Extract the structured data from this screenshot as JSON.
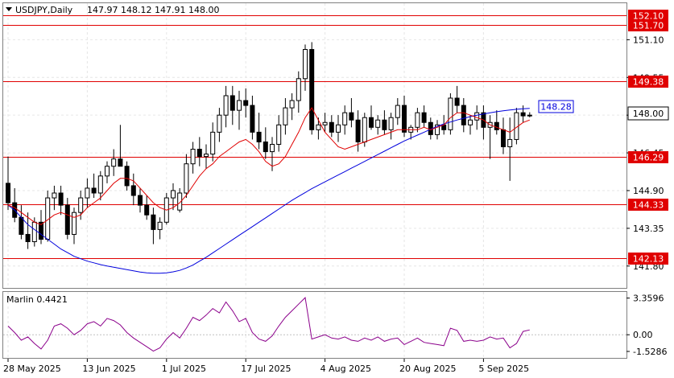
{
  "header": {
    "symbol": "USDJPY,Daily",
    "ohlc": "147.97 148.12 147.91 148.00"
  },
  "chart_data": [
    {
      "type": "candlestick",
      "title": "USDJPY,Daily",
      "ylim": [
        140.9,
        152.6
      ],
      "price_axis_ticks": [
        "151.10",
        "149.55",
        "148.00",
        "146.45",
        "144.90",
        "143.35",
        "141.80"
      ],
      "x_labels": [
        {
          "label": "28 May 2025",
          "index": 0
        },
        {
          "label": "13 Jun 2025",
          "index": 12
        },
        {
          "label": "1 Jul 2025",
          "index": 24
        },
        {
          "label": "17 Jul 2025",
          "index": 36
        },
        {
          "label": "4 Aug 2025",
          "index": 48
        },
        {
          "label": "20 Aug 2025",
          "index": 60
        },
        {
          "label": "5 Sep 2025",
          "index": 72
        }
      ],
      "current_price": "148.00",
      "ma_value_label": "148.28",
      "levels": [
        {
          "value": 152.1,
          "label": "152.10",
          "color": "#e00000"
        },
        {
          "value": 151.7,
          "label": "151.70",
          "color": "#e00000"
        },
        {
          "value": 149.38,
          "label": "149.38",
          "color": "#e00000"
        },
        {
          "value": 146.29,
          "label": "146.29",
          "color": "#e00000"
        },
        {
          "value": 144.33,
          "label": "144.33",
          "color": "#e00000"
        },
        {
          "value": 142.13,
          "label": "142.13",
          "color": "#e00000"
        }
      ],
      "colors": {
        "candles": "#000000",
        "fast_ma": "#e00000",
        "slow_ma": "#0000dd",
        "levels": "#e00000",
        "ma_label": "#0000dd"
      },
      "ohlc": [
        [
          145.2,
          146.3,
          144.1,
          144.4
        ],
        [
          144.4,
          145.0,
          143.6,
          143.8
        ],
        [
          143.8,
          144.3,
          142.9,
          143.1
        ],
        [
          143.1,
          144.0,
          142.5,
          142.8
        ],
        [
          142.8,
          143.8,
          142.6,
          143.6
        ],
        [
          143.6,
          144.1,
          142.7,
          142.9
        ],
        [
          142.9,
          144.9,
          142.8,
          144.6
        ],
        [
          144.6,
          145.1,
          144.1,
          144.8
        ],
        [
          144.8,
          145.1,
          143.9,
          144.3
        ],
        [
          144.3,
          144.6,
          142.9,
          143.1
        ],
        [
          143.1,
          144.2,
          142.7,
          144.0
        ],
        [
          144.0,
          144.9,
          143.7,
          144.6
        ],
        [
          144.6,
          145.4,
          144.2,
          145.0
        ],
        [
          145.0,
          145.6,
          144.6,
          144.8
        ],
        [
          144.8,
          145.7,
          144.5,
          145.5
        ],
        [
          145.5,
          146.1,
          145.2,
          145.9
        ],
        [
          145.9,
          146.6,
          145.5,
          146.2
        ],
        [
          146.2,
          147.6,
          146.0,
          145.9
        ],
        [
          145.9,
          146.1,
          144.9,
          145.1
        ],
        [
          145.1,
          145.6,
          144.3,
          144.7
        ],
        [
          144.7,
          145.0,
          144.0,
          144.3
        ],
        [
          144.3,
          144.7,
          143.7,
          143.9
        ],
        [
          143.9,
          144.2,
          142.7,
          143.3
        ],
        [
          143.3,
          143.8,
          142.9,
          143.6
        ],
        [
          143.6,
          144.8,
          143.5,
          144.6
        ],
        [
          144.6,
          145.2,
          144.1,
          144.9
        ],
        [
          144.1,
          145.0,
          144.0,
          144.8
        ],
        [
          144.8,
          146.4,
          144.6,
          146.0
        ],
        [
          146.0,
          146.9,
          145.6,
          146.6
        ],
        [
          146.6,
          147.1,
          145.9,
          146.3
        ],
        [
          146.3,
          146.8,
          145.8,
          146.4
        ],
        [
          146.4,
          147.7,
          146.1,
          147.3
        ],
        [
          147.3,
          148.3,
          146.9,
          148.0
        ],
        [
          148.0,
          149.2,
          147.5,
          148.8
        ],
        [
          148.8,
          149.2,
          147.6,
          148.2
        ],
        [
          148.2,
          149.0,
          147.4,
          148.6
        ],
        [
          148.6,
          149.1,
          147.9,
          148.4
        ],
        [
          148.4,
          148.8,
          147.0,
          147.3
        ],
        [
          147.3,
          148.1,
          146.6,
          146.9
        ],
        [
          146.9,
          147.5,
          146.2,
          146.5
        ],
        [
          146.5,
          147.1,
          145.7,
          146.8
        ],
        [
          146.8,
          148.0,
          146.5,
          147.6
        ],
        [
          147.6,
          148.7,
          147.2,
          148.3
        ],
        [
          148.3,
          148.9,
          147.8,
          148.6
        ],
        [
          148.6,
          149.8,
          148.1,
          149.5
        ],
        [
          149.5,
          150.9,
          149.0,
          150.7
        ],
        [
          150.7,
          151.0,
          147.2,
          147.4
        ],
        [
          147.4,
          147.9,
          147.0,
          147.6
        ],
        [
          147.6,
          148.1,
          147.3,
          147.7
        ],
        [
          147.7,
          148.0,
          147.1,
          147.3
        ],
        [
          147.3,
          148.0,
          146.9,
          147.6
        ],
        [
          147.6,
          148.4,
          147.2,
          148.1
        ],
        [
          148.1,
          148.7,
          147.5,
          147.8
        ],
        [
          147.8,
          148.2,
          146.5,
          146.9
        ],
        [
          146.9,
          148.1,
          146.7,
          147.9
        ],
        [
          147.9,
          148.4,
          147.4,
          147.5
        ],
        [
          147.5,
          148.0,
          147.2,
          147.8
        ],
        [
          147.8,
          148.2,
          147.2,
          147.4
        ],
        [
          147.4,
          148.1,
          147.0,
          147.9
        ],
        [
          147.9,
          148.7,
          147.6,
          148.4
        ],
        [
          148.4,
          148.8,
          147.1,
          147.3
        ],
        [
          147.3,
          147.6,
          147.0,
          147.5
        ],
        [
          147.5,
          148.3,
          147.3,
          148.1
        ],
        [
          148.1,
          148.4,
          147.5,
          147.7
        ],
        [
          147.7,
          147.9,
          147.0,
          147.2
        ],
        [
          147.2,
          147.8,
          147.0,
          147.6
        ],
        [
          147.6,
          148.0,
          147.2,
          147.4
        ],
        [
          147.4,
          148.9,
          147.2,
          148.7
        ],
        [
          148.7,
          149.2,
          148.1,
          148.4
        ],
        [
          148.4,
          148.7,
          147.3,
          147.6
        ],
        [
          147.6,
          148.0,
          147.2,
          147.8
        ],
        [
          147.8,
          148.4,
          147.4,
          148.1
        ],
        [
          148.1,
          148.4,
          147.0,
          147.5
        ],
        [
          147.5,
          148.0,
          146.2,
          147.7
        ],
        [
          147.7,
          148.2,
          147.2,
          147.4
        ],
        [
          147.4,
          147.9,
          146.4,
          146.7
        ],
        [
          146.7,
          147.9,
          145.3,
          147.0
        ],
        [
          147.0,
          148.3,
          146.8,
          148.1
        ],
        [
          148.1,
          148.4,
          147.7,
          147.97
        ],
        [
          147.97,
          148.12,
          147.91,
          148.0
        ]
      ],
      "fast_ma": [
        144.3,
        144.2,
        144.0,
        143.8,
        143.6,
        143.5,
        143.7,
        143.9,
        144.0,
        143.9,
        143.8,
        143.9,
        144.2,
        144.4,
        144.6,
        144.9,
        145.2,
        145.4,
        145.4,
        145.3,
        145.0,
        144.7,
        144.4,
        144.2,
        144.1,
        144.2,
        144.4,
        144.7,
        145.1,
        145.5,
        145.8,
        146.0,
        146.3,
        146.5,
        146.7,
        146.9,
        147.0,
        146.8,
        146.5,
        146.1,
        145.9,
        146.0,
        146.3,
        146.8,
        147.3,
        147.9,
        148.3,
        147.8,
        147.3,
        147.0,
        146.7,
        146.6,
        146.7,
        146.8,
        146.9,
        147.0,
        147.1,
        147.2,
        147.3,
        147.4,
        147.4,
        147.4,
        147.4,
        147.5,
        147.4,
        147.5,
        147.6,
        147.9,
        148.1,
        148.1,
        148.0,
        147.9,
        147.8,
        147.6,
        147.5,
        147.4,
        147.3,
        147.5,
        147.7,
        147.8
      ],
      "slow_ma": [
        144.3,
        144.1,
        143.8,
        143.5,
        143.3,
        143.1,
        142.9,
        142.7,
        142.5,
        142.35,
        142.2,
        142.1,
        142.0,
        141.93,
        141.86,
        141.8,
        141.75,
        141.7,
        141.65,
        141.6,
        141.55,
        141.52,
        141.5,
        141.5,
        141.52,
        141.56,
        141.62,
        141.72,
        141.84,
        142.0,
        142.16,
        142.34,
        142.52,
        142.7,
        142.88,
        143.06,
        143.24,
        143.42,
        143.6,
        143.78,
        143.96,
        144.14,
        144.32,
        144.5,
        144.66,
        144.82,
        144.98,
        145.12,
        145.26,
        145.4,
        145.54,
        145.68,
        145.82,
        145.96,
        146.1,
        146.24,
        146.38,
        146.52,
        146.66,
        146.8,
        146.94,
        147.06,
        147.18,
        147.3,
        147.42,
        147.54,
        147.64,
        147.72,
        147.8,
        147.87,
        147.94,
        148.0,
        148.05,
        148.1,
        148.14,
        148.18,
        148.21,
        148.24,
        148.26,
        148.28
      ]
    },
    {
      "type": "line",
      "title": "Marlin 0.4421",
      "ylim": [
        -1.9,
        3.7
      ],
      "y_ticks": [
        "3.3596",
        "0.00",
        "-1.5286"
      ],
      "colors": {
        "line": "#8b008b",
        "zero": "#808080"
      },
      "values": [
        0.8,
        0.2,
        -0.5,
        -0.2,
        -0.8,
        -1.3,
        -0.5,
        0.8,
        1.0,
        0.6,
        0.0,
        0.4,
        1.0,
        1.2,
        0.8,
        1.5,
        1.3,
        0.9,
        0.2,
        -0.3,
        -0.7,
        -1.1,
        -1.5,
        -1.2,
        -0.4,
        0.2,
        -0.3,
        0.6,
        1.6,
        1.3,
        1.8,
        2.4,
        2.0,
        3.0,
        2.2,
        1.2,
        1.5,
        0.2,
        -0.4,
        -0.6,
        -0.1,
        0.8,
        1.6,
        2.2,
        2.8,
        3.4,
        -0.4,
        -0.2,
        0.0,
        -0.3,
        -0.4,
        -0.2,
        -0.5,
        -0.6,
        -0.3,
        -0.5,
        -0.2,
        -0.6,
        -0.4,
        -0.3,
        -0.9,
        -0.6,
        -0.3,
        -0.7,
        -0.8,
        -0.9,
        -1.0,
        0.6,
        0.4,
        -0.6,
        -0.5,
        -0.6,
        -0.5,
        -0.2,
        -0.4,
        -0.3,
        -1.2,
        -0.8,
        0.3,
        0.4421
      ]
    }
  ]
}
